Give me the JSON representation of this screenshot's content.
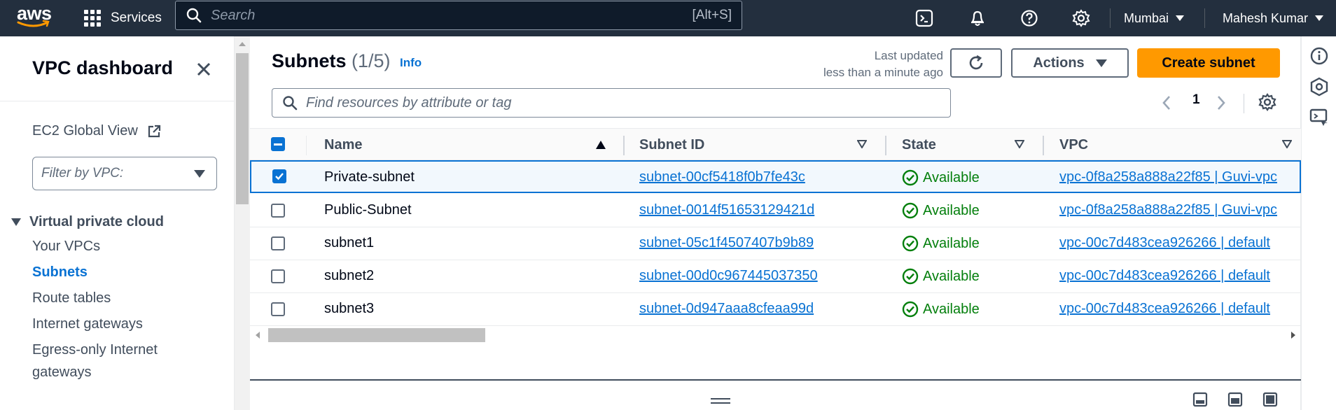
{
  "topnav": {
    "logo": "aws",
    "services_label": "Services",
    "search_placeholder": "Search",
    "search_shortcut": "[Alt+S]",
    "region": "Mumbai",
    "user": "Mahesh Kumar",
    "icons": [
      "cloudshell-icon",
      "notifications-icon",
      "help-icon",
      "settings-icon"
    ]
  },
  "sidebar": {
    "title": "VPC dashboard",
    "global_view": "EC2 Global View",
    "filter_placeholder": "Filter by VPC:",
    "section": "Virtual private cloud",
    "items": [
      {
        "label": "Your VPCs",
        "active": false
      },
      {
        "label": "Subnets",
        "active": true
      },
      {
        "label": "Route tables",
        "active": false
      },
      {
        "label": "Internet gateways",
        "active": false
      },
      {
        "label": "Egress-only Internet gateways",
        "active": false
      }
    ]
  },
  "main": {
    "title": "Subnets",
    "count": "(1/5)",
    "info": "Info",
    "last_updated_line1": "Last updated",
    "last_updated_line2": "less than a minute ago",
    "actions_label": "Actions",
    "create_label": "Create subnet",
    "search_placeholder": "Find resources by attribute or tag",
    "page": "1",
    "columns": [
      "Name",
      "Subnet ID",
      "State",
      "VPC"
    ],
    "rows": [
      {
        "name": "Private-subnet",
        "id": "subnet-00cf5418f0b7fe43c",
        "state": "Available",
        "vpc": "vpc-0f8a258a888a22f85 | Guvi-vpc",
        "selected": true
      },
      {
        "name": "Public-Subnet",
        "id": "subnet-0014f51653129421d",
        "state": "Available",
        "vpc": "vpc-0f8a258a888a22f85 | Guvi-vpc",
        "selected": false
      },
      {
        "name": "subnet1",
        "id": "subnet-05c1f4507407b9b89",
        "state": "Available",
        "vpc": "vpc-00c7d483cea926266 | default",
        "selected": false
      },
      {
        "name": "subnet2",
        "id": "subnet-00d0c967445037350",
        "state": "Available",
        "vpc": "vpc-00c7d483cea926266 | default",
        "selected": false
      },
      {
        "name": "subnet3",
        "id": "subnet-0d947aaa8cfeaa99d",
        "state": "Available",
        "vpc": "vpc-00c7d483cea926266 | default",
        "selected": false
      }
    ]
  },
  "colors": {
    "nav_bg": "#232f3e",
    "link": "#0972d3",
    "primary": "#ff9900",
    "success": "#037f0c"
  }
}
